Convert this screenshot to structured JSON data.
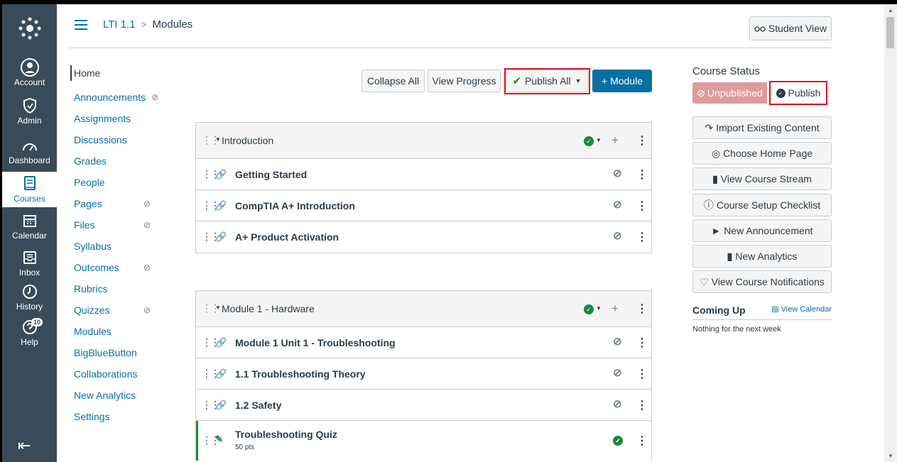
{
  "breadcrumb": {
    "course": "LTI 1.1",
    "separator": ">",
    "page": "Modules"
  },
  "header": {
    "student_view": "Student View",
    "student_view_icon": "glasses-icon"
  },
  "global_nav": [
    {
      "label": "Account",
      "icon": "user-icon"
    },
    {
      "label": "Admin",
      "icon": "shield-icon"
    },
    {
      "label": "Dashboard",
      "icon": "dashboard-icon"
    },
    {
      "label": "Courses",
      "icon": "book-icon",
      "active": true
    },
    {
      "label": "Calendar",
      "icon": "calendar-icon"
    },
    {
      "label": "Inbox",
      "icon": "inbox-icon"
    },
    {
      "label": "History",
      "icon": "clock-icon"
    },
    {
      "label": "Help",
      "icon": "help-icon",
      "badge": "10"
    }
  ],
  "course_nav": [
    {
      "label": "Home",
      "active": true
    },
    {
      "label": "Announcements",
      "hidden": true
    },
    {
      "label": "Assignments"
    },
    {
      "label": "Discussions"
    },
    {
      "label": "Grades"
    },
    {
      "label": "People"
    },
    {
      "label": "Pages",
      "hidden": true
    },
    {
      "label": "Files",
      "hidden": true
    },
    {
      "label": "Syllabus"
    },
    {
      "label": "Outcomes",
      "hidden": true
    },
    {
      "label": "Rubrics"
    },
    {
      "label": "Quizzes",
      "hidden": true
    },
    {
      "label": "Modules"
    },
    {
      "label": "BigBlueButton"
    },
    {
      "label": "Collaborations"
    },
    {
      "label": "New Analytics"
    },
    {
      "label": "Settings"
    }
  ],
  "toolbar": {
    "collapse_all": "Collapse All",
    "view_progress": "View Progress",
    "publish_all": "Publish All",
    "add_module": "+ Module"
  },
  "modules": [
    {
      "title": "Introduction",
      "items": [
        {
          "title": "Getting Started"
        },
        {
          "title": "CompTIA A+ Introduction"
        },
        {
          "title": "A+ Product Activation"
        }
      ]
    },
    {
      "title": "Module 1 - Hardware",
      "items": [
        {
          "title": "Module 1 Unit 1 - Troubleshooting"
        },
        {
          "title": "1.1 Troubleshooting Theory"
        },
        {
          "title": "1.2 Safety"
        },
        {
          "title": "Troubleshooting Quiz",
          "sub": "50 pts",
          "published": true
        }
      ]
    }
  ],
  "sidebar": {
    "course_status": "Course Status",
    "unpublished": "Unpublished",
    "publish": "Publish",
    "buttons": [
      "Import Existing Content",
      "Choose Home Page",
      "View Course Stream",
      "Course Setup Checklist",
      "New Announcement",
      "New Analytics",
      "View Course Notifications"
    ],
    "coming_up": "Coming Up",
    "view_calendar": "View Calendar",
    "nothing": "Nothing for the next week"
  },
  "colors": {
    "nav_bg": "#394b58",
    "link": "#0770a3",
    "primary": "#0770a3",
    "success": "#1a8a3c",
    "highlight": "#e0101c"
  }
}
